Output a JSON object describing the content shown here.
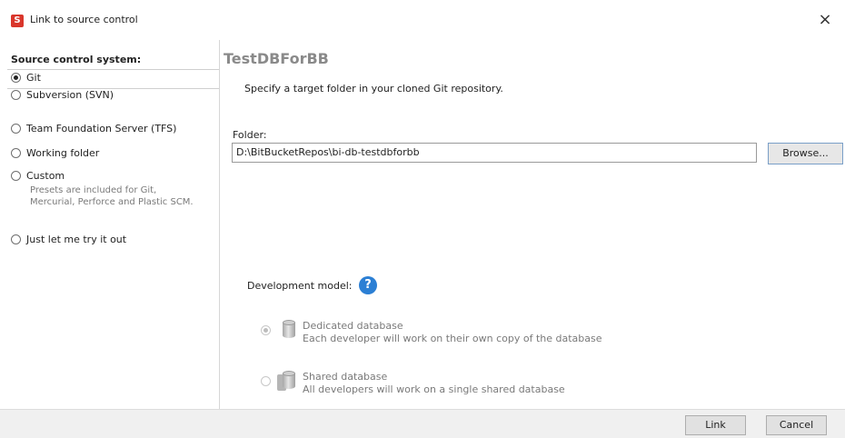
{
  "window": {
    "title": "Link to source control",
    "app_icon_glyph": "S",
    "close_glyph": "×"
  },
  "sidebar": {
    "header": "Source control system:",
    "options": [
      {
        "label": "Git",
        "selected": true
      },
      {
        "label": "Subversion (SVN)",
        "selected": false
      },
      {
        "label": "Team Foundation Server (TFS)",
        "selected": false
      },
      {
        "label": "Working folder",
        "selected": false
      },
      {
        "label": "Custom",
        "selected": false,
        "hint": "Presets are included for Git, Mercurial, Perforce and Plastic SCM."
      },
      {
        "label": "Just let me try it out",
        "selected": false
      }
    ]
  },
  "main": {
    "page_title": "TestDBForBB",
    "instruction": "Specify a target folder in your cloned Git repository.",
    "folder_label": "Folder:",
    "folder_value": "D:\\BitBucketRepos\\bi-db-testdbforbb",
    "browse_label": "Browse...",
    "development_model_label": "Development model:",
    "help_glyph": "?",
    "models": [
      {
        "title": "Dedicated database",
        "description": "Each developer will work on their own copy of the database",
        "selected": true
      },
      {
        "title": "Shared database",
        "description": "All developers will work on a single shared database",
        "selected": false
      }
    ]
  },
  "footer": {
    "link_label": "Link",
    "cancel_label": "Cancel"
  },
  "colors": {
    "accent": "#2b7fd4",
    "app_icon": "#d9362b"
  }
}
